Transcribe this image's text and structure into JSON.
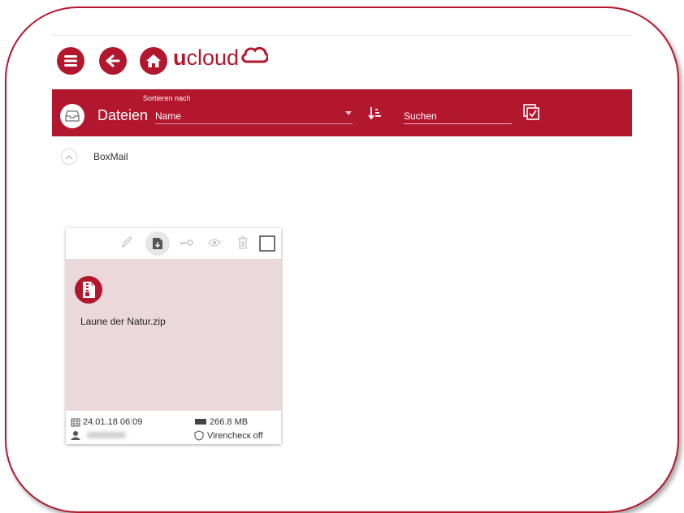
{
  "header": {
    "brand_u": "u",
    "brand_rest": "cloud"
  },
  "icons": {
    "menu": "menu-icon",
    "back": "arrow-left-icon",
    "home": "home-icon",
    "cloud": "cloud-icon"
  },
  "toolbar": {
    "title": "Dateien",
    "sort_label": "Sortieren nach",
    "sort_value": "Name",
    "search_placeholder": "Suchen"
  },
  "breadcrumb": {
    "folder": "BoxMail"
  },
  "files": [
    {
      "name": "Laune der Natur.zip",
      "date": "24.01.18 06:09",
      "size": "266.8 MB",
      "virus_check": "Virenchecк off"
    }
  ],
  "colors": {
    "accent": "#b3172d",
    "card_body": "#ead8da"
  }
}
